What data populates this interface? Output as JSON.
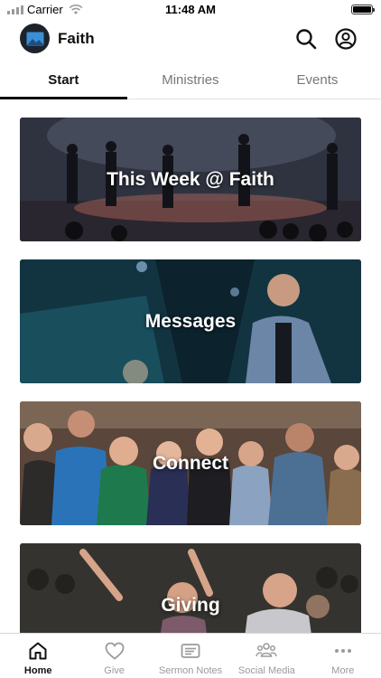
{
  "status_bar": {
    "carrier": "Carrier",
    "time": "11:48 AM"
  },
  "header": {
    "app_name": "Faith",
    "logo_icon": "mountain-photo-icon",
    "search_icon": "search-icon",
    "profile_icon": "user-circle-icon"
  },
  "tabs": [
    {
      "label": "Start",
      "active": true
    },
    {
      "label": "Ministries",
      "active": false
    },
    {
      "label": "Events",
      "active": false
    }
  ],
  "cards": [
    {
      "title": "This Week @ Faith",
      "image": "worship-band-stage"
    },
    {
      "title": "Messages",
      "image": "pastor-speaking"
    },
    {
      "title": "Connect",
      "image": "group-of-people"
    },
    {
      "title": "Giving",
      "image": "congregation-worship"
    }
  ],
  "bottom_nav": [
    {
      "label": "Home",
      "icon": "home-icon",
      "active": true
    },
    {
      "label": "Give",
      "icon": "heart-icon",
      "active": false
    },
    {
      "label": "Sermon Notes",
      "icon": "notes-icon",
      "active": false
    },
    {
      "label": "Social Media",
      "icon": "people-icon",
      "active": false
    },
    {
      "label": "More",
      "icon": "more-dots-icon",
      "active": false
    }
  ],
  "colors": {
    "accent": "#111111",
    "inactive": "#9a9a9a",
    "logo_bg": "#1d232b",
    "logo_blue": "#3a8fd6"
  }
}
